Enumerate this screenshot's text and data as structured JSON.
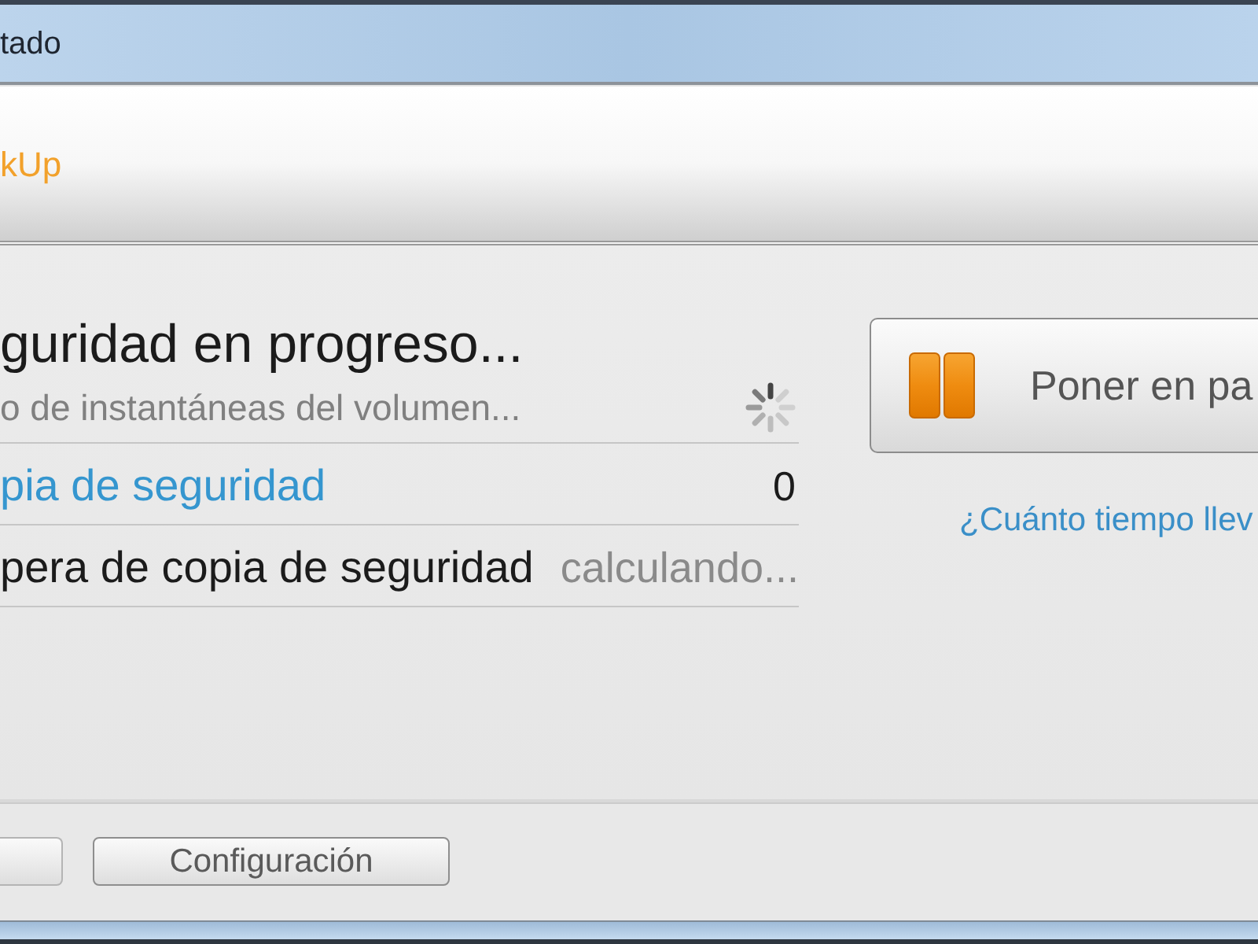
{
  "window": {
    "title": "tado"
  },
  "header": {
    "product_name": "kUp"
  },
  "status": {
    "heading": "guridad en progreso...",
    "detail": "o de instantáneas del volumen...",
    "busy": true
  },
  "rows": [
    {
      "kind": "link",
      "label": "pia de seguridad",
      "value": "0"
    },
    {
      "kind": "text",
      "label": "pera de copia de seguridad",
      "value": "calculando..."
    }
  ],
  "pause_button": {
    "label": "Poner en pa"
  },
  "help_link": "¿Cuánto tiempo llev",
  "footer_buttons": [
    {
      "disabled": true
    },
    {
      "label": "Configuración",
      "disabled": false
    }
  ]
}
